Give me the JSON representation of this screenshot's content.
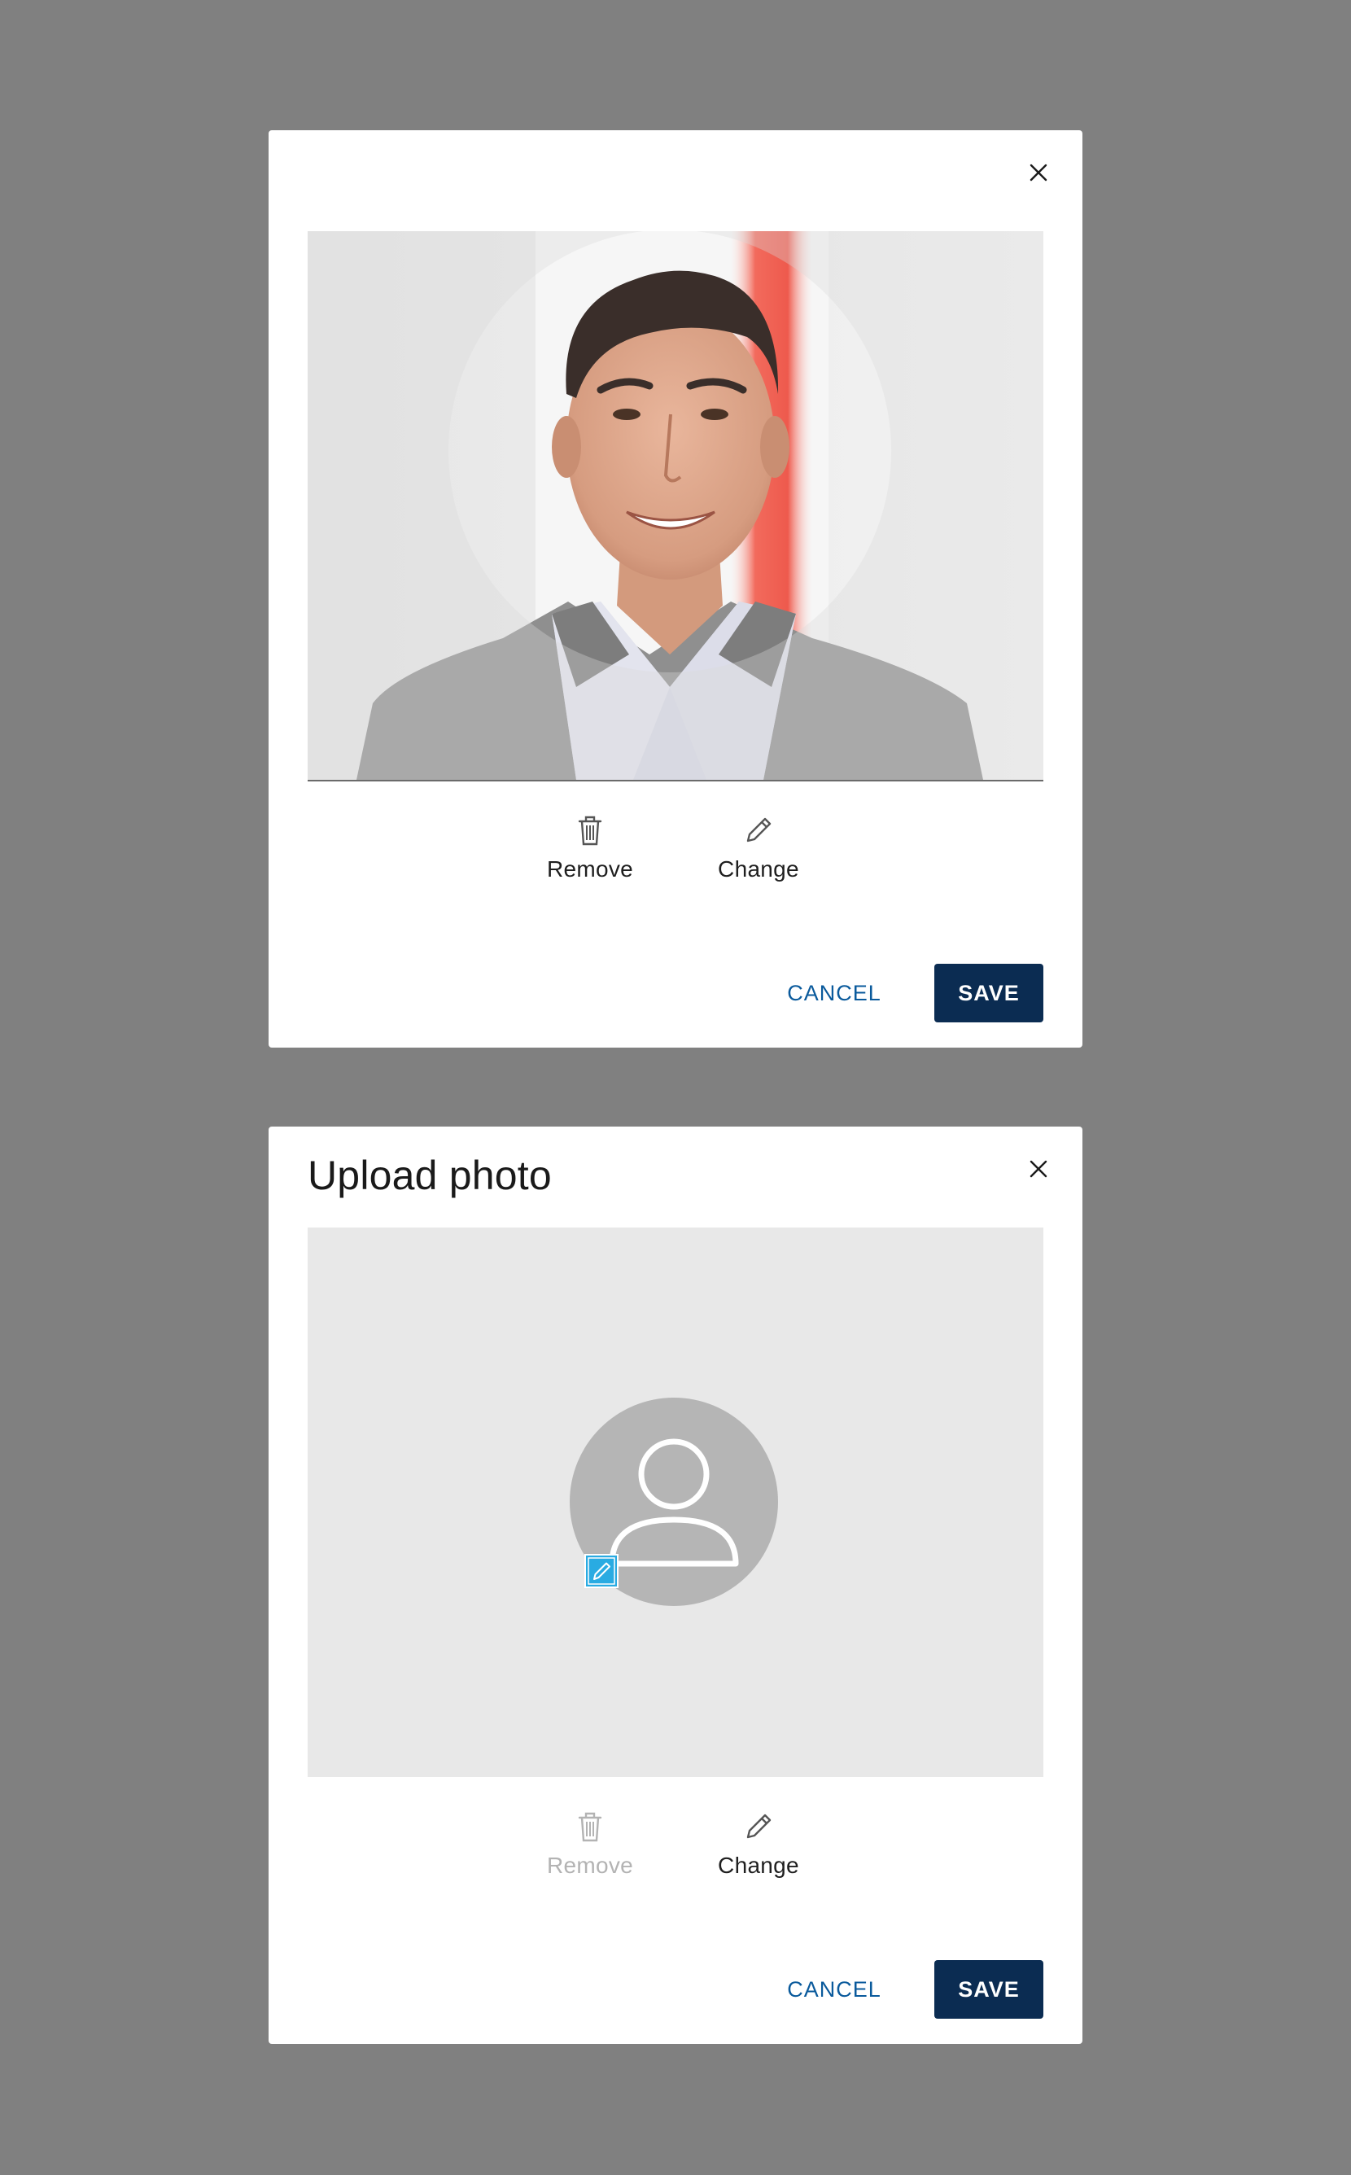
{
  "colors": {
    "backdrop": "#808080",
    "primary": "#0b2c52",
    "link": "#0a5a9c",
    "disabled": "#b3b3b3",
    "badge": "#29abe2"
  },
  "edit_dialog": {
    "close_icon": "close-icon",
    "photo_alt": "Profile photo preview with circular crop",
    "remove_label": "Remove",
    "change_label": "Change",
    "cancel_label": "CANCEL",
    "save_label": "SAVE"
  },
  "upload_dialog": {
    "title": "Upload photo",
    "close_icon": "close-icon",
    "remove_label": "Remove",
    "change_label": "Change",
    "cancel_label": "CANCEL",
    "save_label": "SAVE"
  },
  "icons": {
    "remove": "trash-icon",
    "change": "pencil-icon",
    "placeholder": "user-icon",
    "badge": "edit-badge-icon"
  }
}
